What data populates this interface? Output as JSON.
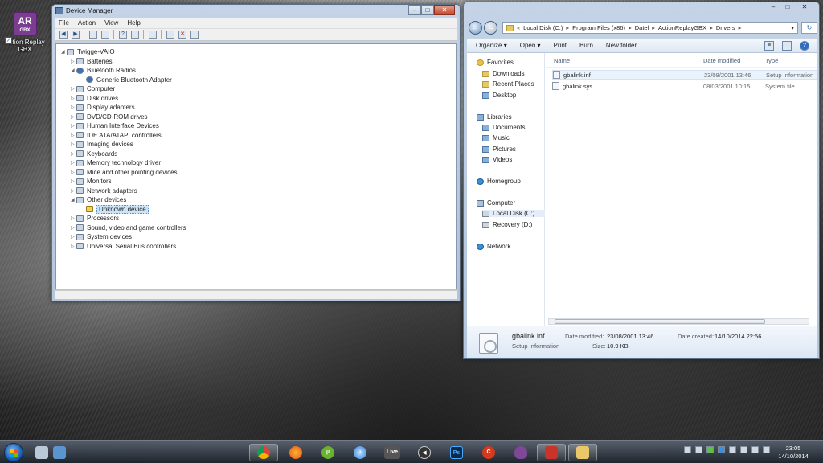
{
  "desktop": {
    "icon_logo_main": "AR",
    "icon_logo_sub": "GBX",
    "icon_label": "Action Replay GBX"
  },
  "device_manager": {
    "title": "Device Manager",
    "menu": [
      "File",
      "Action",
      "View",
      "Help"
    ],
    "tree": [
      {
        "label": "Twigge-VAIO",
        "level": 0,
        "expanded": true,
        "icon": "computer-icon"
      },
      {
        "label": "Batteries",
        "level": 1,
        "expanded": false,
        "icon": "battery-icon"
      },
      {
        "label": "Bluetooth Radios",
        "level": 1,
        "expanded": true,
        "icon": "bluetooth-icon"
      },
      {
        "label": "Generic Bluetooth Adapter",
        "level": 2,
        "expanded": null,
        "icon": "bluetooth-icon"
      },
      {
        "label": "Computer",
        "level": 1,
        "expanded": false,
        "icon": "computer-icon"
      },
      {
        "label": "Disk drives",
        "level": 1,
        "expanded": false,
        "icon": "disk-icon"
      },
      {
        "label": "Display adapters",
        "level": 1,
        "expanded": false,
        "icon": "display-icon"
      },
      {
        "label": "DVD/CD-ROM drives",
        "level": 1,
        "expanded": false,
        "icon": "dvd-icon"
      },
      {
        "label": "Human Interface Devices",
        "level": 1,
        "expanded": false,
        "icon": "hid-icon"
      },
      {
        "label": "IDE ATA/ATAPI controllers",
        "level": 1,
        "expanded": false,
        "icon": "ide-icon"
      },
      {
        "label": "Imaging devices",
        "level": 1,
        "expanded": false,
        "icon": "camera-icon"
      },
      {
        "label": "Keyboards",
        "level": 1,
        "expanded": false,
        "icon": "keyboard-icon"
      },
      {
        "label": "Memory technology driver",
        "level": 1,
        "expanded": false,
        "icon": "memory-icon"
      },
      {
        "label": "Mice and other pointing devices",
        "level": 1,
        "expanded": false,
        "icon": "mouse-icon"
      },
      {
        "label": "Monitors",
        "level": 1,
        "expanded": false,
        "icon": "monitor-icon"
      },
      {
        "label": "Network adapters",
        "level": 1,
        "expanded": false,
        "icon": "network-icon"
      },
      {
        "label": "Other devices",
        "level": 1,
        "expanded": true,
        "icon": "other-devices-icon"
      },
      {
        "label": "Unknown device",
        "level": 2,
        "expanded": null,
        "icon": "warning-icon",
        "selected": true
      },
      {
        "label": "Processors",
        "level": 1,
        "expanded": false,
        "icon": "processor-icon"
      },
      {
        "label": "Sound, video and game controllers",
        "level": 1,
        "expanded": false,
        "icon": "sound-icon"
      },
      {
        "label": "System devices",
        "level": 1,
        "expanded": false,
        "icon": "system-icon"
      },
      {
        "label": "Universal Serial Bus controllers",
        "level": 1,
        "expanded": false,
        "icon": "usb-icon"
      }
    ]
  },
  "explorer": {
    "path": [
      "Local Disk (C:)",
      "Program Files (x86)",
      "Datel",
      "ActionReplayGBX",
      "Drivers"
    ],
    "commands": [
      "Organize",
      "Open",
      "Print",
      "Burn",
      "New folder"
    ],
    "nav": [
      {
        "label": "Favorites",
        "kind": "header",
        "icon": "star-icon"
      },
      {
        "label": "Downloads",
        "kind": "item",
        "icon": "downloads-icon"
      },
      {
        "label": "Recent Places",
        "kind": "item",
        "icon": "recent-places-icon"
      },
      {
        "label": "Desktop",
        "kind": "item",
        "icon": "desktop-icon"
      },
      {
        "label": "Libraries",
        "kind": "header",
        "icon": "libraries-icon"
      },
      {
        "label": "Documents",
        "kind": "item",
        "icon": "documents-icon"
      },
      {
        "label": "Music",
        "kind": "item",
        "icon": "music-icon"
      },
      {
        "label": "Pictures",
        "kind": "item",
        "icon": "pictures-icon"
      },
      {
        "label": "Videos",
        "kind": "item",
        "icon": "videos-icon"
      },
      {
        "label": "Homegroup",
        "kind": "header",
        "icon": "homegroup-icon"
      },
      {
        "label": "Computer",
        "kind": "header",
        "icon": "computer-icon"
      },
      {
        "label": "Local Disk (C:)",
        "kind": "item",
        "icon": "drive-icon",
        "active": true
      },
      {
        "label": "Recovery (D:)",
        "kind": "item",
        "icon": "drive-icon"
      },
      {
        "label": "Network",
        "kind": "header",
        "icon": "network-icon"
      }
    ],
    "columns": {
      "name": "Name",
      "date": "Date modified",
      "type": "Type"
    },
    "files": [
      {
        "name": "gbalink.inf",
        "date": "23/08/2001 13:46",
        "type": "Setup Information"
      },
      {
        "name": "gbalink.sys",
        "date": "08/03/2001 10:15",
        "type": "System file"
      }
    ],
    "details": {
      "name": "gbalink.inf",
      "type": "Setup Information",
      "modified_label": "Date modified:",
      "modified": "23/08/2001 13:46",
      "created_label": "Date created:",
      "created": "14/10/2014 22:56",
      "size_label": "Size:",
      "size": "10.9 KB"
    }
  },
  "taskbar": {
    "time": "23:05",
    "date": "14/10/2014",
    "live_label": "Live",
    "ps_label": "Ps"
  }
}
